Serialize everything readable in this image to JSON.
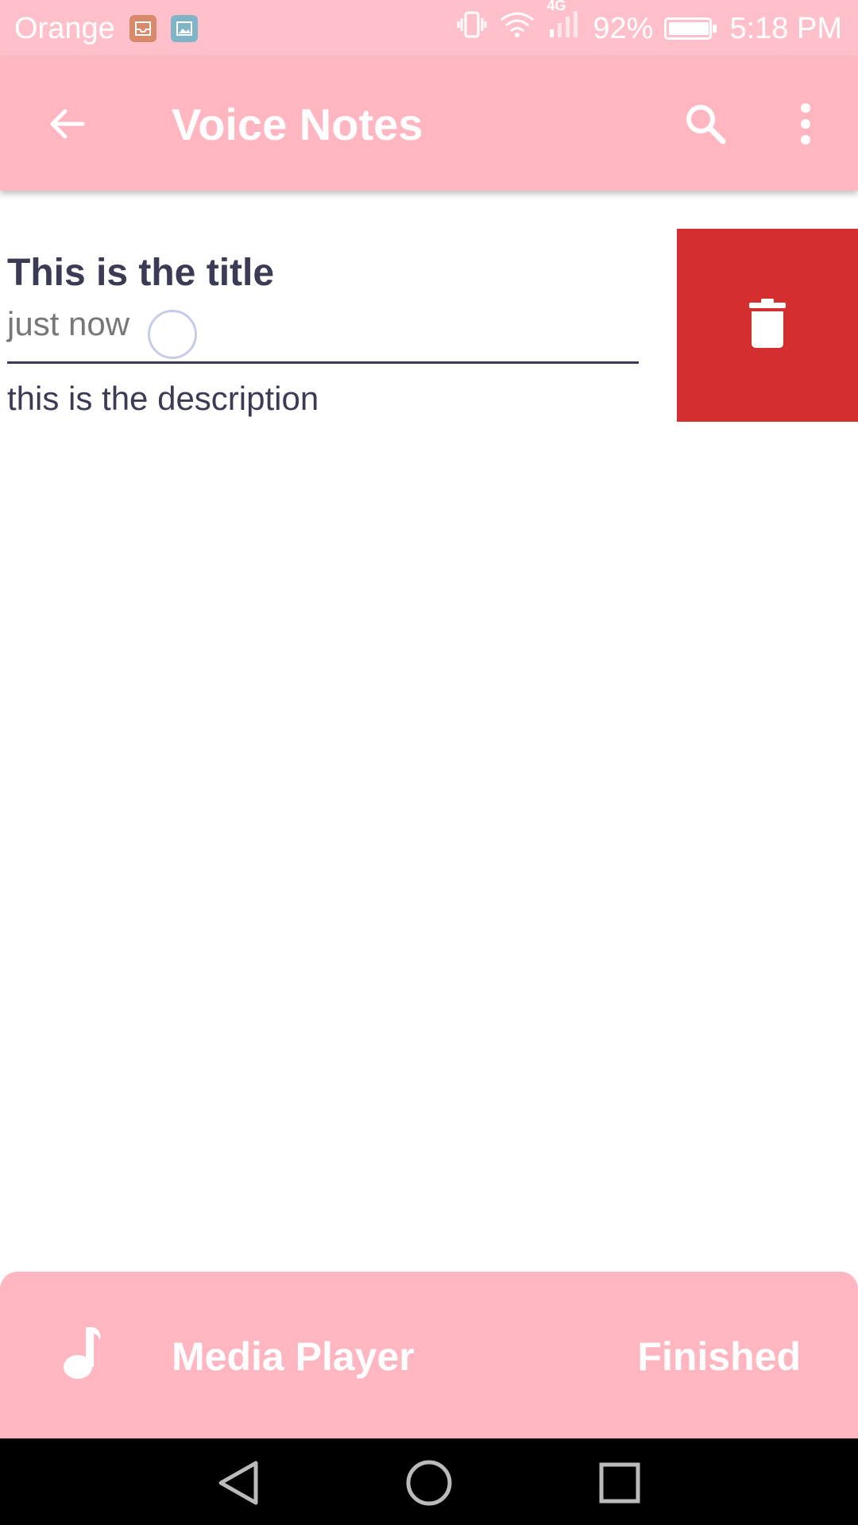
{
  "status_bar": {
    "carrier": "Orange",
    "network": "4G",
    "battery": "92%",
    "time": "5:18 PM",
    "icons": [
      "inbox-app-icon",
      "gallery-app-icon",
      "vibrate-icon",
      "wifi-icon",
      "signal-icon",
      "battery-icon"
    ]
  },
  "app_bar": {
    "title": "Voice Notes",
    "icons": [
      "back-arrow-icon",
      "search-icon",
      "more-vert-icon"
    ]
  },
  "note": {
    "title": "This is the title",
    "time": "just now",
    "description": "this is the description"
  },
  "delete_action": {
    "icon": "trash-icon",
    "color": "#d32f2f"
  },
  "media_player": {
    "icon": "music-note-icon",
    "title": "Media Player",
    "status": "Finished"
  },
  "nav_bar": {
    "icons": [
      "back-triangle-icon",
      "home-circle-icon",
      "recents-square-icon"
    ]
  },
  "colors": {
    "status_bar": "#ffc0cb",
    "app_bar": "#ffb6c1",
    "accent_text": "#3b3b55",
    "delete": "#d32f2f"
  }
}
